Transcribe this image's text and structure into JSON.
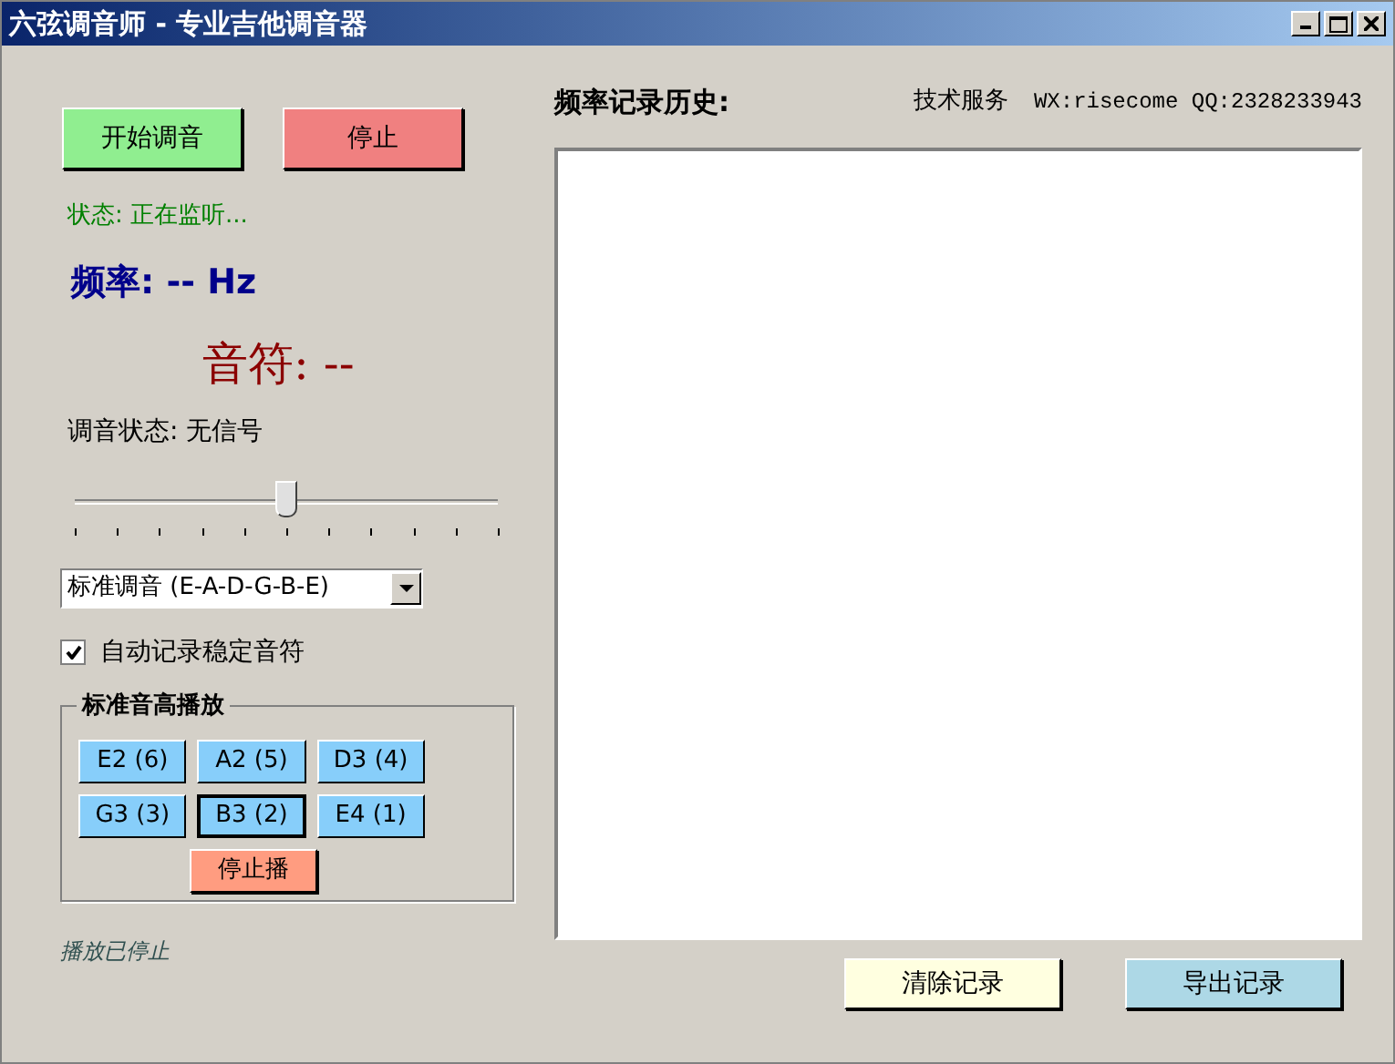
{
  "window": {
    "title": "六弦调音师 - 专业吉他调音器"
  },
  "controls": {
    "start_button": "开始调音",
    "stop_button": "停止"
  },
  "status": "状态: 正在监听...",
  "frequency": "频率: -- Hz",
  "note": "音符: --",
  "tuning_status": "调音状态: 无信号",
  "tuning_slider": {
    "level": 0.5
  },
  "tuning_select": {
    "value": "标准调音 (E-A-D-G-B-E)"
  },
  "auto_record": {
    "label": "自动记录稳定音符",
    "checked": true
  },
  "reference_group": {
    "title": "标准音高播放",
    "notes": [
      {
        "label": "E2 (6)",
        "selected": false
      },
      {
        "label": "A2 (5)",
        "selected": false
      },
      {
        "label": "D3 (4)",
        "selected": false
      },
      {
        "label": "G3 (3)",
        "selected": false
      },
      {
        "label": "B3 (2)",
        "selected": true
      },
      {
        "label": "E4 (1)",
        "selected": false
      }
    ],
    "stop_button": "停止播"
  },
  "playback_status": "播放已停止",
  "history": {
    "title": "频率记录历史:",
    "support": "技术服务",
    "contact": "WX:risecome QQ:2328233943"
  },
  "bottom_buttons": {
    "clear": "清除记录",
    "export": "导出记录"
  }
}
